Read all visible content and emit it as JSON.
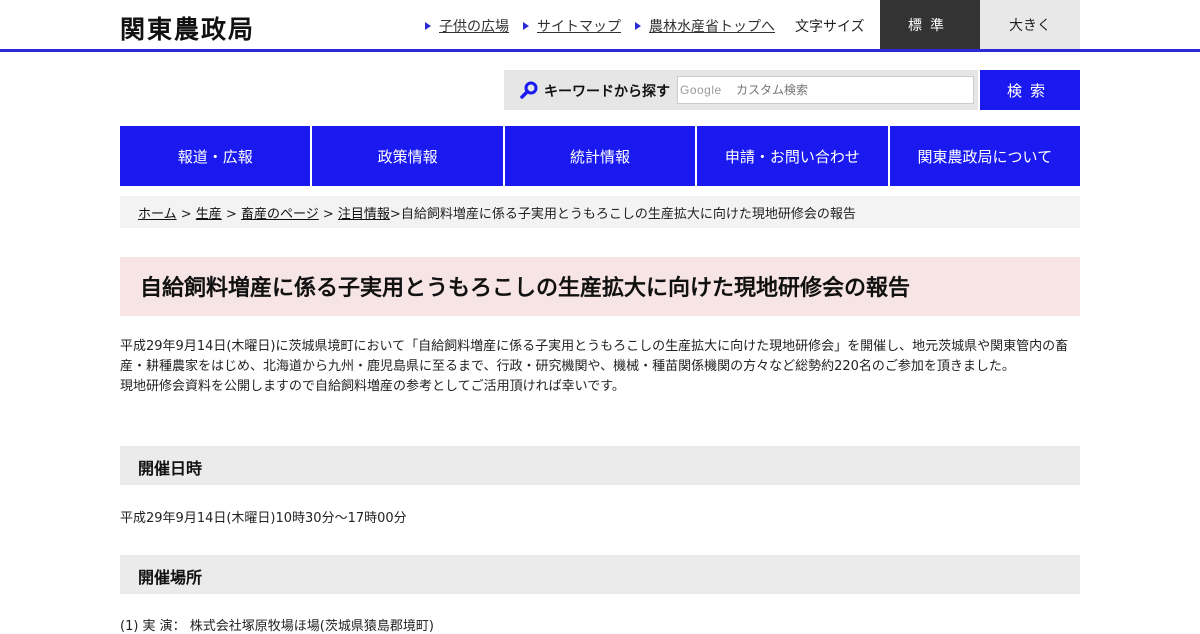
{
  "header": {
    "site_title": "関東農政局",
    "util_links": [
      "子供の広場",
      "サイトマップ",
      "農林水産省トップへ"
    ],
    "font_size_label": "文字サイズ",
    "font_size_standard": "標準",
    "font_size_large": "大きく"
  },
  "search": {
    "label": "キーワードから探す",
    "google_mark": "Google",
    "placeholder": "カスタム検索",
    "button_label": "検索"
  },
  "nav": {
    "items": [
      "報道・広報",
      "政策情報",
      "統計情報",
      "申請・お問い合わせ",
      "関東農政局について"
    ]
  },
  "breadcrumb": {
    "links": [
      "ホーム",
      "生産",
      "畜産のページ",
      "注目情報"
    ],
    "separator": " > ",
    "current": "自給飼料増産に係る子実用とうもろこしの生産拡大に向けた現地研修会の報告"
  },
  "page": {
    "title": "自給飼料増産に係る子実用とうもろこしの生産拡大に向けた現地研修会の報告",
    "intro_1": "平成29年9月14日(木曜日)に茨城県境町において「自給飼料増産に係る子実用とうもろこしの生産拡大に向けた現地研修会」を開催し、地元茨城県や関東管内の畜産・耕種農家をはじめ、北海道から九州・鹿児島県に至るまで、行政・研究機関や、機械・種苗関係機関の方々など総勢約220名のご参加を頂きました。",
    "intro_2": "現地研修会資料を公開しますので自給飼料増産の参考としてご活用頂ければ幸いです。"
  },
  "sections": {
    "date_heading": "開催日時",
    "date_text": "平成29年9月14日(木曜日)10時30分～17時00分",
    "place_heading": "開催場所",
    "place_text": "(1) 実 演： 株式会社塚原牧場ほ場(茨城県猿島郡境町)"
  },
  "colors": {
    "accent_blue": "#1a1af0",
    "header_rule": "#2b2bd6",
    "title_bg": "#f7e4e4",
    "section_bg": "#ebebeb"
  }
}
